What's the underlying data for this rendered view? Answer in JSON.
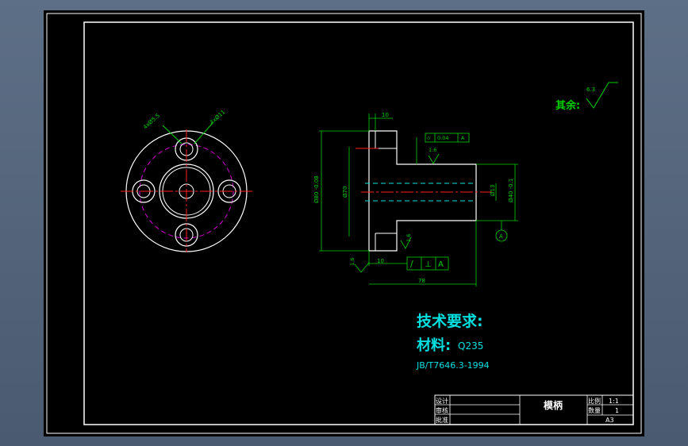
{
  "drawing": {
    "surface_note": "其余:",
    "surface_value": "6.3",
    "tech_requirements": "技术要求:",
    "material_label": "材料:",
    "material_value": "Q235",
    "standard": "JB/T7646.3-1994",
    "front_view_labels": {
      "hole_small": "4xØ5.5",
      "hole_large": "4xØ11"
    },
    "side_view_labels": {
      "flange_thickness": "10",
      "flange_dia": "Ø80 -0.08",
      "inner_dia": "Ø70",
      "shaft_dia": "Ø40 -0.1",
      "bore_dia": "Ø13",
      "bottom_width": "10",
      "total_length": "78",
      "roughness_shaft": "1.6",
      "roughness_flange": "1.6",
      "roughness_inner": "1.6",
      "tolerance_top_value": "0.04",
      "tolerance_top_datum": "A",
      "tolerance_bottom_datum": "A",
      "datum_marker": "A"
    }
  },
  "title_block": {
    "part_name": "模柄",
    "row_designed": "设计",
    "row_checked": "审核",
    "row_approved": "批准",
    "scale_label": "比例",
    "scale_value": "1:1",
    "qty_label": "数量",
    "qty_value": "1",
    "paper_size": "A3"
  },
  "colors": {
    "background": "#000000",
    "frame": "#ffffff",
    "dimension": "#00d000",
    "center_line": "#ff2020",
    "pitch_circle": "#d000d0",
    "text_cyan": "#00e0e0"
  }
}
